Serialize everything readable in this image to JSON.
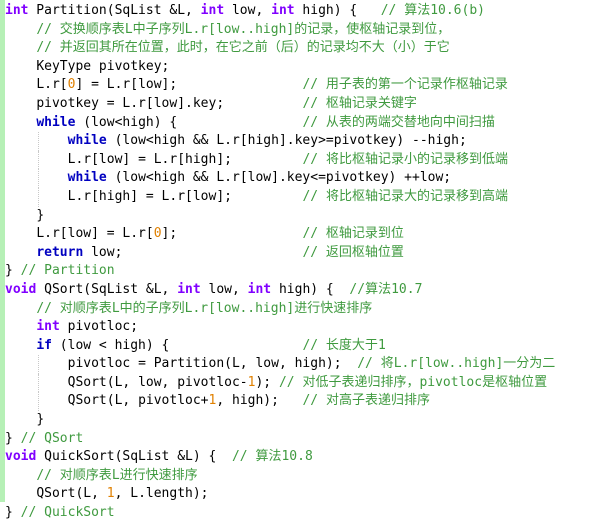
{
  "app": {
    "kind": "code-editor-snippet",
    "language": "C",
    "colors": {
      "background": "#ffffff",
      "change_bar": "#b6f0b6",
      "keyword": "#0000c0",
      "type_keyword": "#8000ff",
      "comment": "#3f9a3f",
      "number": "#e08000",
      "plain_text": "#000000",
      "indent_guide": "#c8c8c8"
    }
  },
  "gutter": {
    "change_bar_visible": true
  },
  "code": {
    "lines": [
      {
        "indent": 0,
        "guides": [],
        "tokens": [
          {
            "t": "int",
            "c": "type"
          },
          {
            "t": " Partition(SqList &L, ",
            "c": "plain"
          },
          {
            "t": "int",
            "c": "type"
          },
          {
            "t": " low, ",
            "c": "plain"
          },
          {
            "t": "int",
            "c": "type"
          },
          {
            "t": " high) {   ",
            "c": "plain"
          },
          {
            "t": "// 算法10.6(b)",
            "c": "cmt"
          }
        ]
      },
      {
        "indent": 1,
        "guides": [],
        "tokens": [
          {
            "t": "// 交换顺序表L中子序列L.r[low..high]的记录，使枢轴记录到位，",
            "c": "cmt"
          }
        ]
      },
      {
        "indent": 1,
        "guides": [],
        "tokens": [
          {
            "t": "// 并返回其所在位置，此时，在它之前（后）的记录均不大（小）于它",
            "c": "cmt"
          }
        ]
      },
      {
        "indent": 1,
        "guides": [],
        "tokens": [
          {
            "t": "KeyType pivotkey;",
            "c": "plain"
          }
        ]
      },
      {
        "indent": 1,
        "guides": [],
        "comment_col": 38,
        "tokens": [
          {
            "t": "L.r[",
            "c": "plain"
          },
          {
            "t": "0",
            "c": "num"
          },
          {
            "t": "] = L.r[low];",
            "c": "plain"
          }
        ],
        "comment": "// 用子表的第一个记录作枢轴记录"
      },
      {
        "indent": 1,
        "guides": [],
        "comment_col": 38,
        "tokens": [
          {
            "t": "pivotkey = L.r[low].key;",
            "c": "plain"
          }
        ],
        "comment": "// 枢轴记录关键字"
      },
      {
        "indent": 1,
        "guides": [],
        "comment_col": 38,
        "tokens": [
          {
            "t": "while",
            "c": "kw"
          },
          {
            "t": " (low<high) {",
            "c": "plain"
          }
        ],
        "comment": "// 从表的两端交替地向中间扫描"
      },
      {
        "indent": 2,
        "guides": [
          1
        ],
        "tokens": [
          {
            "t": "while",
            "c": "kw"
          },
          {
            "t": " (low<high && L.r[high].key>=pivotkey) --high;",
            "c": "plain"
          }
        ]
      },
      {
        "indent": 2,
        "guides": [
          1
        ],
        "comment_col": 38,
        "tokens": [
          {
            "t": "L.r[low] = L.r[high];",
            "c": "plain"
          }
        ],
        "comment": "// 将比枢轴记录小的记录移到低端"
      },
      {
        "indent": 2,
        "guides": [
          1
        ],
        "tokens": [
          {
            "t": "while",
            "c": "kw"
          },
          {
            "t": " (low<high && L.r[low].key<=pivotkey) ++low;",
            "c": "plain"
          }
        ]
      },
      {
        "indent": 2,
        "guides": [
          1
        ],
        "comment_col": 38,
        "tokens": [
          {
            "t": "L.r[high] = L.r[low];",
            "c": "plain"
          }
        ],
        "comment": "// 将比枢轴记录大的记录移到高端"
      },
      {
        "indent": 1,
        "guides": [],
        "tokens": [
          {
            "t": "}",
            "c": "plain"
          }
        ]
      },
      {
        "indent": 1,
        "guides": [],
        "comment_col": 38,
        "tokens": [
          {
            "t": "L.r[low] = L.r[",
            "c": "plain"
          },
          {
            "t": "0",
            "c": "num"
          },
          {
            "t": "];",
            "c": "plain"
          }
        ],
        "comment": "// 枢轴记录到位"
      },
      {
        "indent": 1,
        "guides": [],
        "comment_col": 38,
        "tokens": [
          {
            "t": "return",
            "c": "kw"
          },
          {
            "t": " low;",
            "c": "plain"
          }
        ],
        "comment": "// 返回枢轴位置"
      },
      {
        "indent": 0,
        "guides": [],
        "tokens": [
          {
            "t": "} ",
            "c": "plain"
          },
          {
            "t": "// Partition",
            "c": "cmt"
          }
        ]
      },
      {
        "indent": 0,
        "guides": [],
        "tokens": [
          {
            "t": "void",
            "c": "type"
          },
          {
            "t": " QSort(SqList &L, ",
            "c": "plain"
          },
          {
            "t": "int",
            "c": "type"
          },
          {
            "t": " low, ",
            "c": "plain"
          },
          {
            "t": "int",
            "c": "type"
          },
          {
            "t": " high) {  ",
            "c": "plain"
          },
          {
            "t": "//算法10.7",
            "c": "cmt"
          }
        ]
      },
      {
        "indent": 1,
        "guides": [],
        "tokens": [
          {
            "t": "// 对顺序表L中的子序列L.r[low..high]进行快速排序",
            "c": "cmt"
          }
        ]
      },
      {
        "indent": 1,
        "guides": [],
        "tokens": [
          {
            "t": "int",
            "c": "type"
          },
          {
            "t": " pivotloc;",
            "c": "plain"
          }
        ]
      },
      {
        "indent": 1,
        "guides": [],
        "comment_col": 38,
        "tokens": [
          {
            "t": "if",
            "c": "kw"
          },
          {
            "t": " (low < high) {",
            "c": "plain"
          }
        ],
        "comment": "// 长度大于1"
      },
      {
        "indent": 2,
        "guides": [
          1
        ],
        "tokens": [
          {
            "t": "pivotloc = Partition(L, low, high);  ",
            "c": "plain"
          },
          {
            "t": "// 将L.r[low..high]一分为二",
            "c": "cmt"
          }
        ]
      },
      {
        "indent": 2,
        "guides": [
          1
        ],
        "tokens": [
          {
            "t": "QSort(L, low, pivotloc-",
            "c": "plain"
          },
          {
            "t": "1",
            "c": "num"
          },
          {
            "t": "); ",
            "c": "plain"
          },
          {
            "t": "// 对低子表递归排序，pivotloc是枢轴位置",
            "c": "cmt"
          }
        ]
      },
      {
        "indent": 2,
        "guides": [
          1
        ],
        "comment_col": 38,
        "tokens": [
          {
            "t": "QSort(L, pivotloc+",
            "c": "plain"
          },
          {
            "t": "1",
            "c": "num"
          },
          {
            "t": ", high);",
            "c": "plain"
          }
        ],
        "comment": "// 对高子表递归排序"
      },
      {
        "indent": 1,
        "guides": [],
        "tokens": [
          {
            "t": "}",
            "c": "plain"
          }
        ]
      },
      {
        "indent": 0,
        "guides": [],
        "tokens": [
          {
            "t": "} ",
            "c": "plain"
          },
          {
            "t": "// QSort",
            "c": "cmt"
          }
        ]
      },
      {
        "indent": 0,
        "guides": [],
        "tokens": [
          {
            "t": "void",
            "c": "type"
          },
          {
            "t": " QuickSort(SqList &L) {  ",
            "c": "plain"
          },
          {
            "t": "// 算法10.8",
            "c": "cmt"
          }
        ]
      },
      {
        "indent": 1,
        "guides": [],
        "tokens": [
          {
            "t": "// 对顺序表L进行快速排序",
            "c": "cmt"
          }
        ]
      },
      {
        "indent": 1,
        "guides": [],
        "tokens": [
          {
            "t": "QSort(L, ",
            "c": "plain"
          },
          {
            "t": "1",
            "c": "num"
          },
          {
            "t": ", L.length);",
            "c": "plain"
          }
        ]
      },
      {
        "indent": 0,
        "guides": [],
        "tokens": [
          {
            "t": "} ",
            "c": "plain"
          },
          {
            "t": "// QuickSort",
            "c": "cmt"
          }
        ]
      }
    ]
  }
}
